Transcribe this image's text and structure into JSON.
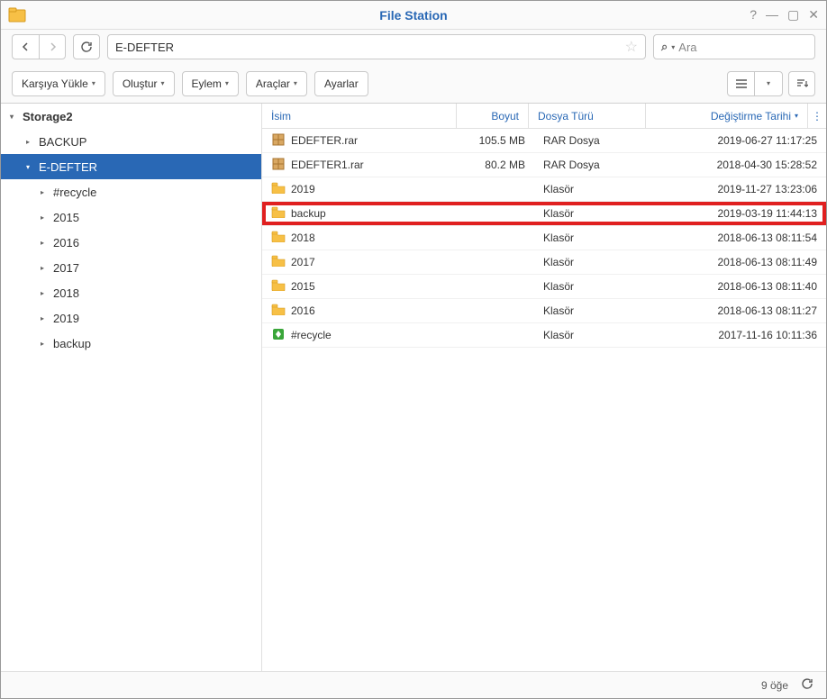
{
  "window": {
    "title": "File Station"
  },
  "nav": {
    "path": "E-DEFTER",
    "search_placeholder": "Ara"
  },
  "toolbar": {
    "upload": "Karşıya Yükle",
    "create": "Oluştur",
    "action": "Eylem",
    "tools": "Araçlar",
    "settings": "Ayarlar"
  },
  "tree": {
    "root": "Storage2",
    "items": [
      {
        "label": "BACKUP",
        "expanded": false,
        "selected": false,
        "level": 1
      },
      {
        "label": "E-DEFTER",
        "expanded": true,
        "selected": true,
        "level": 1
      },
      {
        "label": "#recycle",
        "expanded": false,
        "selected": false,
        "level": 2
      },
      {
        "label": "2015",
        "expanded": false,
        "selected": false,
        "level": 2
      },
      {
        "label": "2016",
        "expanded": false,
        "selected": false,
        "level": 2
      },
      {
        "label": "2017",
        "expanded": false,
        "selected": false,
        "level": 2
      },
      {
        "label": "2018",
        "expanded": false,
        "selected": false,
        "level": 2
      },
      {
        "label": "2019",
        "expanded": false,
        "selected": false,
        "level": 2
      },
      {
        "label": "backup",
        "expanded": false,
        "selected": false,
        "level": 2
      }
    ]
  },
  "columns": {
    "name": "İsim",
    "size": "Boyut",
    "type": "Dosya Türü",
    "modified": "Değiştirme Tarihi"
  },
  "files": [
    {
      "name": "EDEFTER.rar",
      "size": "105.5 MB",
      "type": "RAR Dosya",
      "date": "2019-06-27 11:17:25",
      "kind": "rar",
      "hl": false
    },
    {
      "name": "EDEFTER1.rar",
      "size": "80.2 MB",
      "type": "RAR Dosya",
      "date": "2018-04-30 15:28:52",
      "kind": "rar",
      "hl": false
    },
    {
      "name": "2019",
      "size": "",
      "type": "Klasör",
      "date": "2019-11-27 13:23:06",
      "kind": "folder",
      "hl": false
    },
    {
      "name": "backup",
      "size": "",
      "type": "Klasör",
      "date": "2019-03-19 11:44:13",
      "kind": "folder",
      "hl": true
    },
    {
      "name": "2018",
      "size": "",
      "type": "Klasör",
      "date": "2018-06-13 08:11:54",
      "kind": "folder",
      "hl": false
    },
    {
      "name": "2017",
      "size": "",
      "type": "Klasör",
      "date": "2018-06-13 08:11:49",
      "kind": "folder",
      "hl": false
    },
    {
      "name": "2015",
      "size": "",
      "type": "Klasör",
      "date": "2018-06-13 08:11:40",
      "kind": "folder",
      "hl": false
    },
    {
      "name": "2016",
      "size": "",
      "type": "Klasör",
      "date": "2018-06-13 08:11:27",
      "kind": "folder",
      "hl": false
    },
    {
      "name": "#recycle",
      "size": "",
      "type": "Klasör",
      "date": "2017-11-16 10:11:36",
      "kind": "recycle",
      "hl": false
    }
  ],
  "status": {
    "count": "9 öğe"
  }
}
